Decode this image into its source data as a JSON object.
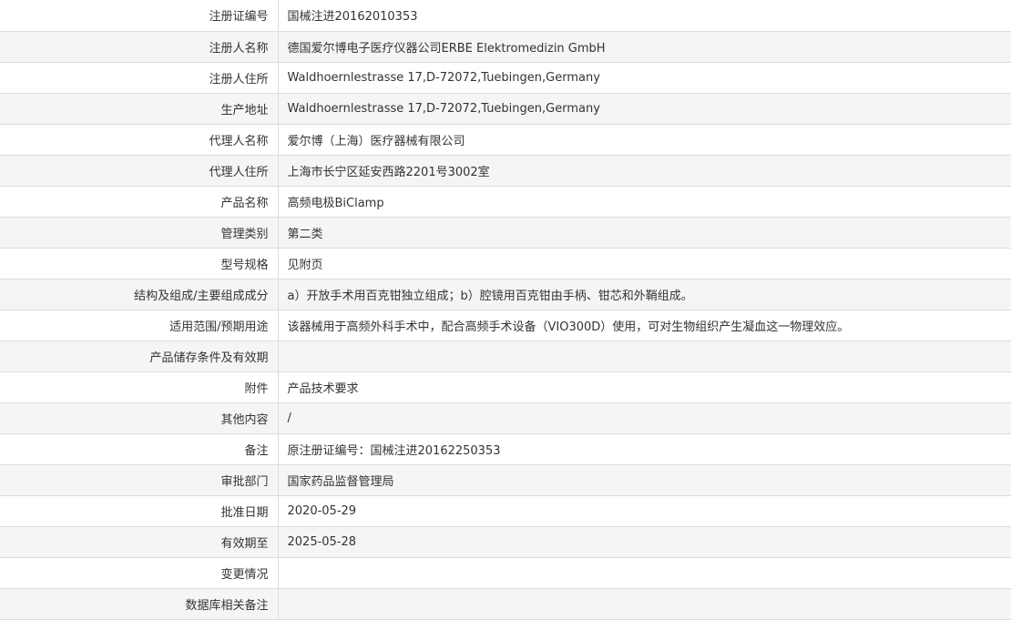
{
  "rows": [
    {
      "label": "注册证编号",
      "value": "国械注进20162010353"
    },
    {
      "label": "注册人名称",
      "value": "德国爱尔博电子医疗仪器公司ERBE Elektromedizin GmbH"
    },
    {
      "label": "注册人住所",
      "value": "Waldhoernlestrasse 17,D-72072,Tuebingen,Germany"
    },
    {
      "label": "生产地址",
      "value": "Waldhoernlestrasse 17,D-72072,Tuebingen,Germany"
    },
    {
      "label": "代理人名称",
      "value": "爱尔博（上海）医疗器械有限公司"
    },
    {
      "label": "代理人住所",
      "value": "上海市长宁区延安西路2201号3002室"
    },
    {
      "label": "产品名称",
      "value": "高频电极BiClamp"
    },
    {
      "label": "管理类别",
      "value": "第二类"
    },
    {
      "label": "型号规格",
      "value": "见附页"
    },
    {
      "label": "结构及组成/主要组成成分",
      "value": "a）开放手术用百克钳独立组成；b）腔镜用百克钳由手柄、钳芯和外鞘组成。"
    },
    {
      "label": "适用范围/预期用途",
      "value": "该器械用于高频外科手术中，配合高频手术设备（VIO300D）使用，可对生物组织产生凝血这一物理效应。"
    },
    {
      "label": "产品储存条件及有效期",
      "value": ""
    },
    {
      "label": "附件",
      "value": "产品技术要求"
    },
    {
      "label": "其他内容",
      "value": "/"
    },
    {
      "label": "备注",
      "value": "原注册证编号：国械注进20162250353"
    },
    {
      "label": "审批部门",
      "value": "国家药品监督管理局"
    },
    {
      "label": "批准日期",
      "value": "2020-05-29"
    },
    {
      "label": "有效期至",
      "value": "2025-05-28"
    },
    {
      "label": "变更情况",
      "value": ""
    },
    {
      "label": "数据库相关备注",
      "value": ""
    }
  ]
}
